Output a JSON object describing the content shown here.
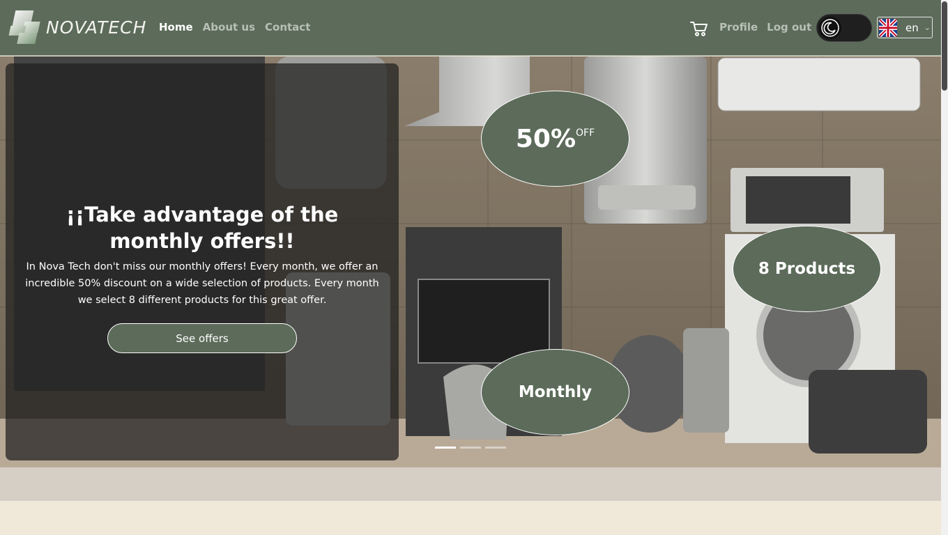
{
  "brand": {
    "name": "NOVATECH"
  },
  "nav": {
    "links": [
      {
        "label": "Home",
        "active": true
      },
      {
        "label": "About us",
        "active": false
      },
      {
        "label": "Contact",
        "active": false
      }
    ],
    "profile_label": "Profile",
    "logout_label": "Log out",
    "cart_icon": "cart-icon",
    "theme_toggle_icon": "moon-icon"
  },
  "language": {
    "selected": "en",
    "flag": "uk-flag-icon"
  },
  "hero": {
    "title": "¡¡Take advantage of the monthly offers!!",
    "description": "In Nova Tech don't miss our monthly offers! Every month, we offer an incredible 50% discount on a wide selection of products. Every month we select 8 different products for this great offer.",
    "button_label": "See offers",
    "bubbles": {
      "discount_value": "50%",
      "discount_suffix": "OFF",
      "products": "8 Products",
      "monthly": "Monthly"
    },
    "slides_count": 3,
    "active_slide": 1
  },
  "colors": {
    "primary": "#5c6b5a",
    "page_background": "#f0e8d8",
    "band": "#d6cfc6"
  }
}
